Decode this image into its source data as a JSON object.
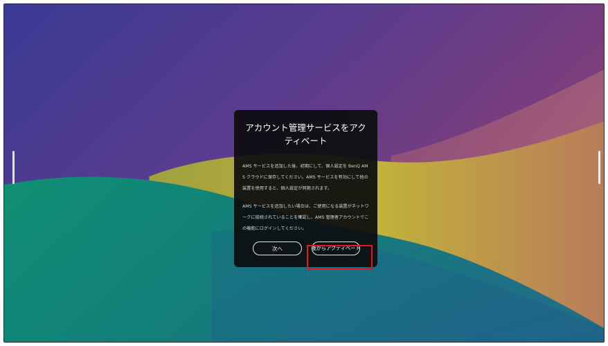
{
  "dialog": {
    "title": "アカウント管理サービスをアクティベート",
    "paragraphs": [
      "AMS サービスを追加した後、初期にして、個人設定を BenQ AMS クラウドに保存してください。AMS サービスを有効にして他の装置を使用すると、個人設定が同期されます。",
      "AMS サービスを追加したい場合は、ご使用になる装置がネットワークに接続されていることを確認し、AMS 管理者アカウントでこの機能にログインしてください。"
    ],
    "next_label": "次へ",
    "later_label": "後からアクティベート"
  },
  "colors": {
    "dialog_bg": "#0c0c0e",
    "highlight": "#e8171c",
    "wallpaper_purple": "#4a3a8f",
    "wallpaper_magenta": "#8a3c6e",
    "wallpaper_yellow": "#b9a83a",
    "wallpaper_teal": "#0f8f7e"
  }
}
